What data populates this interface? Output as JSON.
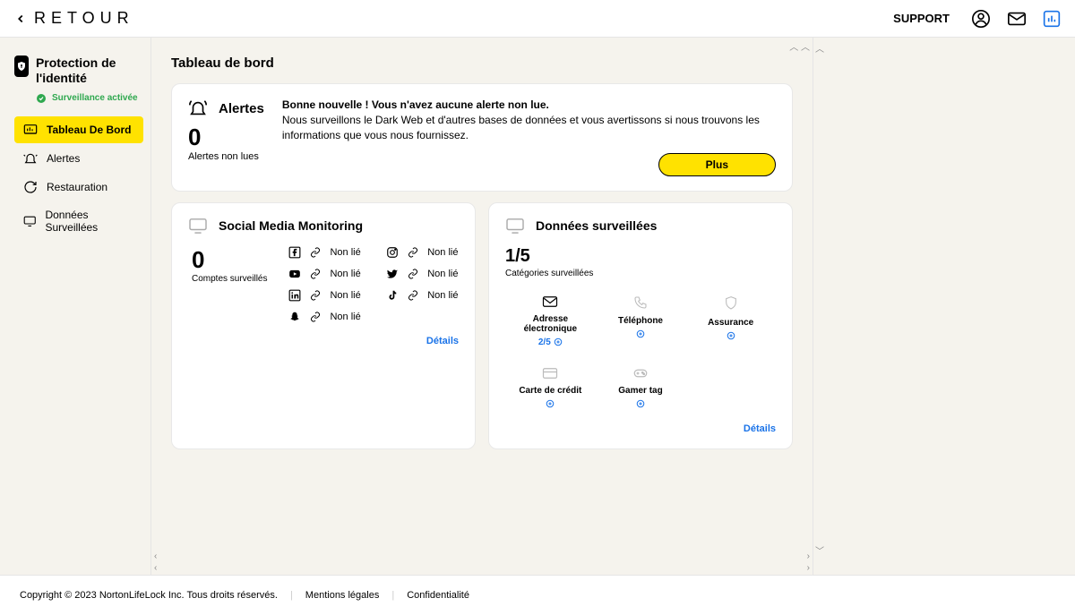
{
  "topbar": {
    "back": "Retour",
    "support": "SUPPORT"
  },
  "app": {
    "title": "Protection de l'identité",
    "status": "Surveillance activée"
  },
  "nav": {
    "dashboard": "Tableau De Bord",
    "alerts": "Alertes",
    "restore": "Restauration",
    "monitored": "Données Surveillées"
  },
  "page_title": "Tableau de bord",
  "alerts": {
    "title": "Alertes",
    "count": "0",
    "sub": "Alertes non lues",
    "good": "Bonne nouvelle ! Vous n'avez aucune alerte non lue.",
    "desc": "Nous surveillons le Dark Web et d'autres bases de données et vous avertissons si nous trouvons les informations que vous nous fournissez.",
    "more": "Plus"
  },
  "sm": {
    "title": "Social Media Monitoring",
    "count": "0",
    "sub": "Comptes surveillés",
    "unlinked": "Non lié",
    "platforms": [
      "Facebook",
      "Instagram",
      "YouTube",
      "Twitter",
      "LinkedIn",
      "TikTok",
      "Snapchat"
    ],
    "details": "Détails"
  },
  "mon": {
    "title": "Données surveillées",
    "ratio": "1/5",
    "sub": "Catégories surveillées",
    "email": "Adresse électronique",
    "email_status": "2/5",
    "phone": "Téléphone",
    "insurance": "Assurance",
    "credit": "Carte de crédit",
    "gamer": "Gamer tag",
    "details": "Détails"
  },
  "footer": {
    "copyright": "Copyright © 2023 NortonLifeLock Inc. Tous droits réservés.",
    "legal": "Mentions légales",
    "privacy": "Confidentialité"
  }
}
